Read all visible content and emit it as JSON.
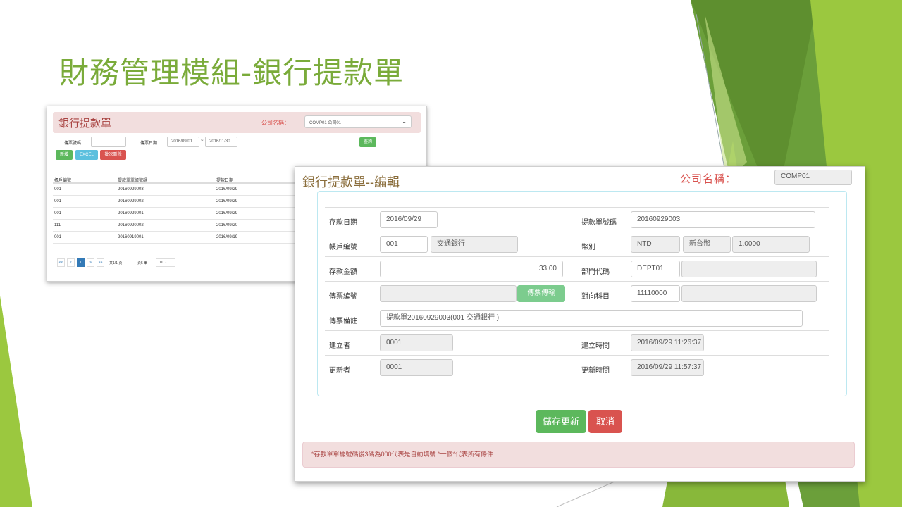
{
  "slide": {
    "title": "財務管理模組-銀行提款單"
  },
  "list_window": {
    "title": "銀行提款單",
    "company_label": "公司名稱：",
    "company_select": "COMP01 公司01",
    "voucher_no_label": "傳票號碼",
    "voucher_date_label": "傳票日期",
    "date_from": "2016/09/01",
    "date_sep": "~",
    "date_to": "2016/11/30",
    "search_button": "查詢",
    "add_button": "新增",
    "excel_button": "EXCEL",
    "batch_button": "批次刪除",
    "columns": [
      "帳戶編號",
      "提款單單據號碼",
      "提款日期"
    ],
    "rows": [
      [
        "001",
        "20160929003",
        "2016/09/29"
      ],
      [
        "001",
        "20160929002",
        "2016/09/29"
      ],
      [
        "001",
        "20160929001",
        "2016/09/29"
      ],
      [
        "111",
        "20160920002",
        "2016/09/20"
      ],
      [
        "001",
        "20160919001",
        "2016/09/19"
      ]
    ],
    "pager": {
      "first": "<<",
      "prev": "<",
      "current": "1",
      "next": ">",
      "last": ">>",
      "total_pages": "共1/1 頁",
      "page_size_label": "頁5 筆",
      "page_size": "10"
    }
  },
  "edit_window": {
    "title": "銀行提款單--編輯",
    "company_label": "公司名稱：",
    "company_value": "COMP01",
    "fields": {
      "deposit_date_label": "存款日期",
      "deposit_date": "2016/09/29",
      "withdraw_no_label": "提款單號碼",
      "withdraw_no": "20160929003",
      "account_no_label": "帳戶編號",
      "account_no": "001",
      "bank_name": "交通銀行",
      "currency_label": "幣別",
      "currency_code": "NTD",
      "currency_name": "新台幣",
      "exchange_rate": "1.0000",
      "amount_label": "存款金額",
      "amount": "33.00",
      "dept_label": "部門代碼",
      "dept_code": "DEPT01",
      "dept_name": "",
      "voucher_no_label": "傳票編號",
      "voucher_no": "",
      "voucher_button": "傳票傳輸",
      "contra_label": "對向科目",
      "contra_code": "11110000",
      "contra_name": "",
      "voucher_memo_label": "傳票備註",
      "voucher_memo": "提款單20160929003(001 交通銀行 )",
      "creator_label": "建立者",
      "creator": "0001",
      "created_at_label": "建立時間",
      "created_at": "2016/09/29 11:26:37",
      "updater_label": "更新者",
      "updater": "0001",
      "updated_at_label": "更新時間",
      "updated_at": "2016/09/29 11:57:37"
    },
    "save_button": "儲存更新",
    "cancel_button": "取消",
    "note": "*存款單單據號碼後3碼為000代表是自動填號 *一個*代表所有條件"
  },
  "colors": {
    "title_green": "#7aab3a",
    "deco_green_light": "#9bc83f",
    "deco_green_dark": "#5e8f2f",
    "danger": "#d9534f",
    "success": "#5cb85c",
    "info": "#5bc0de",
    "alert_bg": "#f2dede"
  }
}
